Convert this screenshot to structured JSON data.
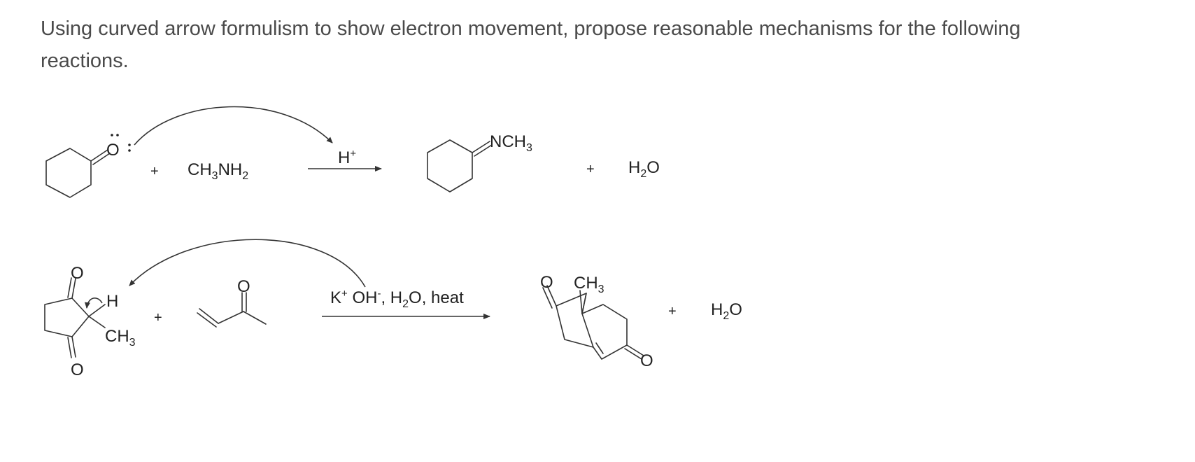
{
  "question": {
    "text": "Using curved arrow formulism to show electron movement, propose reasonable mechanisms for the following reactions."
  },
  "reaction1": {
    "reactant1": {
      "name": "cyclohexanone",
      "oxygen_label": "O"
    },
    "plus1": "+",
    "reactant2": {
      "label_main": "CH",
      "sub1": "3",
      "label_mid": "NH",
      "sub2": "2"
    },
    "reagent": {
      "main": "H",
      "sup": "+"
    },
    "product1": {
      "name": "N-methylcyclohexanimine",
      "label_main": "NCH",
      "sub": "3"
    },
    "plus2": "+",
    "product2": {
      "main1": "H",
      "sub": "2",
      "main2": "O"
    }
  },
  "reaction2": {
    "reactant1": {
      "name": "2-methylcyclopentane-1,3-dione",
      "o_top": "O",
      "o_bottom": "O",
      "h_label": "H",
      "methyl_main": "CH",
      "methyl_sub": "3"
    },
    "plus1": "+",
    "reactant2": {
      "name": "methyl vinyl ketone",
      "oxygen_label": "O"
    },
    "reagent": {
      "k": "K",
      "k_sup": "+",
      "oh": " OH",
      "oh_sup": "-",
      "rest1": ", H",
      "rest_sub": "2",
      "rest2": "O, heat"
    },
    "product1": {
      "name": "Wieland-Miescher-type bicyclic enedione",
      "o_top": "O",
      "methyl_main": "CH",
      "methyl_sub": "3",
      "o_right": "O"
    },
    "plus2": "+",
    "product2": {
      "main1": "H",
      "sub": "2",
      "main2": "O"
    }
  }
}
